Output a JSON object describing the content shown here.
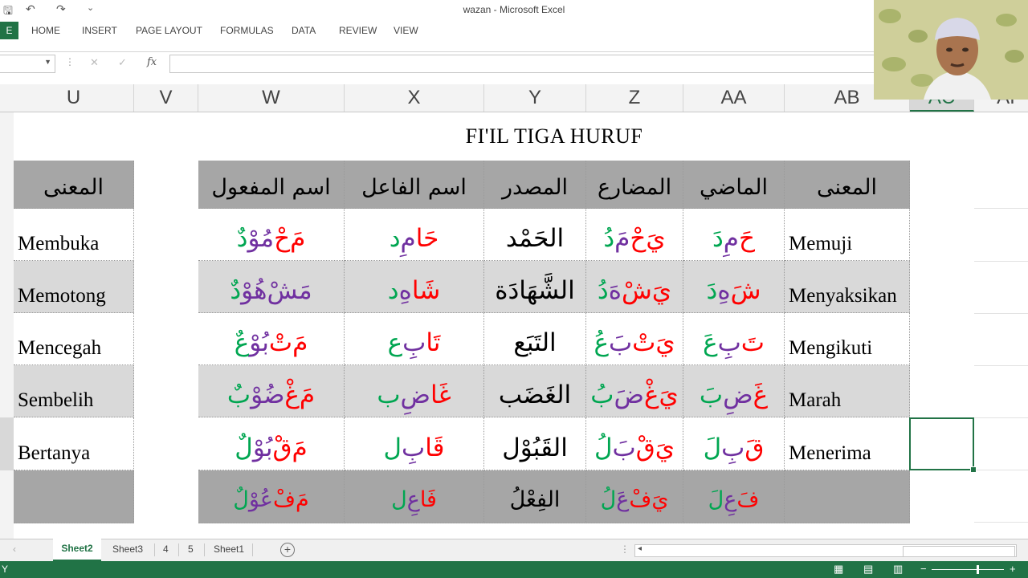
{
  "window": {
    "title": "wazan - Microsoft Excel"
  },
  "quick_access": {
    "save": "🖫",
    "undo": "↶",
    "redo": "↷",
    "customize": "⌄"
  },
  "ribbon": {
    "file_label": "E",
    "tabs": [
      "HOME",
      "INSERT",
      "PAGE LAYOUT",
      "FORMULAS",
      "DATA",
      "REVIEW",
      "VIEW"
    ]
  },
  "formula_bar": {
    "name_box": "",
    "cancel": "✕",
    "enter": "✓",
    "fx": "fx",
    "value": ""
  },
  "columns": [
    "U",
    "V",
    "W",
    "X",
    "Y",
    "Z",
    "AA",
    "AB",
    "AC",
    "AI"
  ],
  "sheet": {
    "title": "FI'IL TIGA HURUF",
    "left_header": "المعنى",
    "headers": [
      "اسم المفعول",
      "اسم الفاعل",
      "المصدر",
      "المضارع",
      "الماضي",
      "المعنى"
    ],
    "rows": [
      {
        "left": "Membuka",
        "ism_maful": [
          {
            "t": "مَ",
            "c": "red"
          },
          {
            "t": "حْ",
            "c": "red"
          },
          {
            "t": "مُوْ",
            "c": "pur"
          },
          {
            "t": "دٌ",
            "c": "grn"
          }
        ],
        "ism_fail": [
          {
            "t": "حَا",
            "c": "red"
          },
          {
            "t": "مِ",
            "c": "pur"
          },
          {
            "t": "د",
            "c": "grn"
          }
        ],
        "masdar": "الحَمْد",
        "mudhari": [
          {
            "t": "يَ",
            "c": "red"
          },
          {
            "t": "حْ",
            "c": "red"
          },
          {
            "t": "مَ",
            "c": "pur"
          },
          {
            "t": "دُ",
            "c": "grn"
          }
        ],
        "madhi": [
          {
            "t": "حَ",
            "c": "red"
          },
          {
            "t": "مِ",
            "c": "pur"
          },
          {
            "t": "دَ",
            "c": "grn"
          }
        ],
        "meaning": "Memuji"
      },
      {
        "left": "Memotong",
        "ism_maful": [
          {
            "t": "مَشْ",
            "c": "pur"
          },
          {
            "t": "هُوْ",
            "c": "pur"
          },
          {
            "t": "دٌ",
            "c": "grn"
          }
        ],
        "ism_fail": [
          {
            "t": "شَا",
            "c": "red"
          },
          {
            "t": "هِ",
            "c": "pur"
          },
          {
            "t": "د",
            "c": "grn"
          }
        ],
        "masdar": "الشَّهَادَة",
        "mudhari": [
          {
            "t": "يَ",
            "c": "red"
          },
          {
            "t": "شْ",
            "c": "red"
          },
          {
            "t": "هَ",
            "c": "pur"
          },
          {
            "t": "دُ",
            "c": "grn"
          }
        ],
        "madhi": [
          {
            "t": "شَ",
            "c": "red"
          },
          {
            "t": "هِ",
            "c": "pur"
          },
          {
            "t": "دَ",
            "c": "grn"
          }
        ],
        "meaning": "Menyaksikan"
      },
      {
        "left": "Mencegah",
        "ism_maful": [
          {
            "t": "مَ",
            "c": "red"
          },
          {
            "t": "تْ",
            "c": "red"
          },
          {
            "t": "بُوْ",
            "c": "pur"
          },
          {
            "t": "عٌ",
            "c": "grn"
          }
        ],
        "ism_fail": [
          {
            "t": "تَا",
            "c": "red"
          },
          {
            "t": "بِ",
            "c": "pur"
          },
          {
            "t": "ع",
            "c": "grn"
          }
        ],
        "masdar": "التَبَع",
        "mudhari": [
          {
            "t": "يَ",
            "c": "red"
          },
          {
            "t": "تْ",
            "c": "red"
          },
          {
            "t": "بَ",
            "c": "pur"
          },
          {
            "t": "عُ",
            "c": "grn"
          }
        ],
        "madhi": [
          {
            "t": "تَ",
            "c": "red"
          },
          {
            "t": "بِ",
            "c": "pur"
          },
          {
            "t": "عَ",
            "c": "grn"
          }
        ],
        "meaning": "Mengikuti"
      },
      {
        "left": "Sembelih",
        "ism_maful": [
          {
            "t": "مَ",
            "c": "red"
          },
          {
            "t": "غْ",
            "c": "red"
          },
          {
            "t": "ضُوْ",
            "c": "pur"
          },
          {
            "t": "بٌ",
            "c": "grn"
          }
        ],
        "ism_fail": [
          {
            "t": "غَا",
            "c": "red"
          },
          {
            "t": "ضِ",
            "c": "pur"
          },
          {
            "t": "ب",
            "c": "grn"
          }
        ],
        "masdar": "الغَضَب",
        "mudhari": [
          {
            "t": "يَ",
            "c": "red"
          },
          {
            "t": "غْ",
            "c": "red"
          },
          {
            "t": "ضَ",
            "c": "pur"
          },
          {
            "t": "بُ",
            "c": "grn"
          }
        ],
        "madhi": [
          {
            "t": "غَ",
            "c": "red"
          },
          {
            "t": "ضِ",
            "c": "pur"
          },
          {
            "t": "بَ",
            "c": "grn"
          }
        ],
        "meaning": "Marah"
      },
      {
        "left": "Bertanya",
        "ism_maful": [
          {
            "t": "مَ",
            "c": "red"
          },
          {
            "t": "قْ",
            "c": "red"
          },
          {
            "t": "بُوْ",
            "c": "pur"
          },
          {
            "t": "لٌ",
            "c": "grn"
          }
        ],
        "ism_fail": [
          {
            "t": "قَا",
            "c": "red"
          },
          {
            "t": "بِ",
            "c": "pur"
          },
          {
            "t": "ل",
            "c": "grn"
          }
        ],
        "masdar": "القَبُوْل",
        "mudhari": [
          {
            "t": "يَ",
            "c": "red"
          },
          {
            "t": "قْ",
            "c": "red"
          },
          {
            "t": "بَ",
            "c": "pur"
          },
          {
            "t": "لُ",
            "c": "grn"
          }
        ],
        "madhi": [
          {
            "t": "قَ",
            "c": "red"
          },
          {
            "t": "بِ",
            "c": "pur"
          },
          {
            "t": "لَ",
            "c": "grn"
          }
        ],
        "meaning": "Menerima"
      },
      {
        "left": "",
        "ism_maful": [
          {
            "t": "مَ",
            "c": "red"
          },
          {
            "t": "فْ",
            "c": "red"
          },
          {
            "t": "عُوْ",
            "c": "pur"
          },
          {
            "t": "لٌ",
            "c": "grn"
          }
        ],
        "ism_fail": [
          {
            "t": "فَا",
            "c": "red"
          },
          {
            "t": "عِ",
            "c": "pur"
          },
          {
            "t": "ل",
            "c": "grn"
          }
        ],
        "masdar": "الفِعْلُ",
        "mudhari": [
          {
            "t": "يَ",
            "c": "red"
          },
          {
            "t": "فْ",
            "c": "red"
          },
          {
            "t": "عَ",
            "c": "pur"
          },
          {
            "t": "لُ",
            "c": "grn"
          }
        ],
        "madhi": [
          {
            "t": "فَ",
            "c": "red"
          },
          {
            "t": "عِ",
            "c": "pur"
          },
          {
            "t": "لَ",
            "c": "grn"
          }
        ],
        "meaning": ""
      }
    ]
  },
  "sheet_tabs": [
    "Sheet2",
    "Sheet3",
    "4",
    "5",
    "Sheet1"
  ],
  "status_bar": {
    "ready": "Y",
    "zoom_out": "−",
    "zoom_in": "+",
    "view_normal_icon": "normal-view-icon",
    "view_layout_icon": "page-layout-icon",
    "view_break_icon": "page-break-icon"
  },
  "colors": {
    "accent": "#217346",
    "header_fill": "#a6a6a6",
    "band_fill": "#d9d9d9",
    "radical_1": "#ff0000",
    "radical_2": "#7030a0",
    "radical_3": "#00a651"
  }
}
